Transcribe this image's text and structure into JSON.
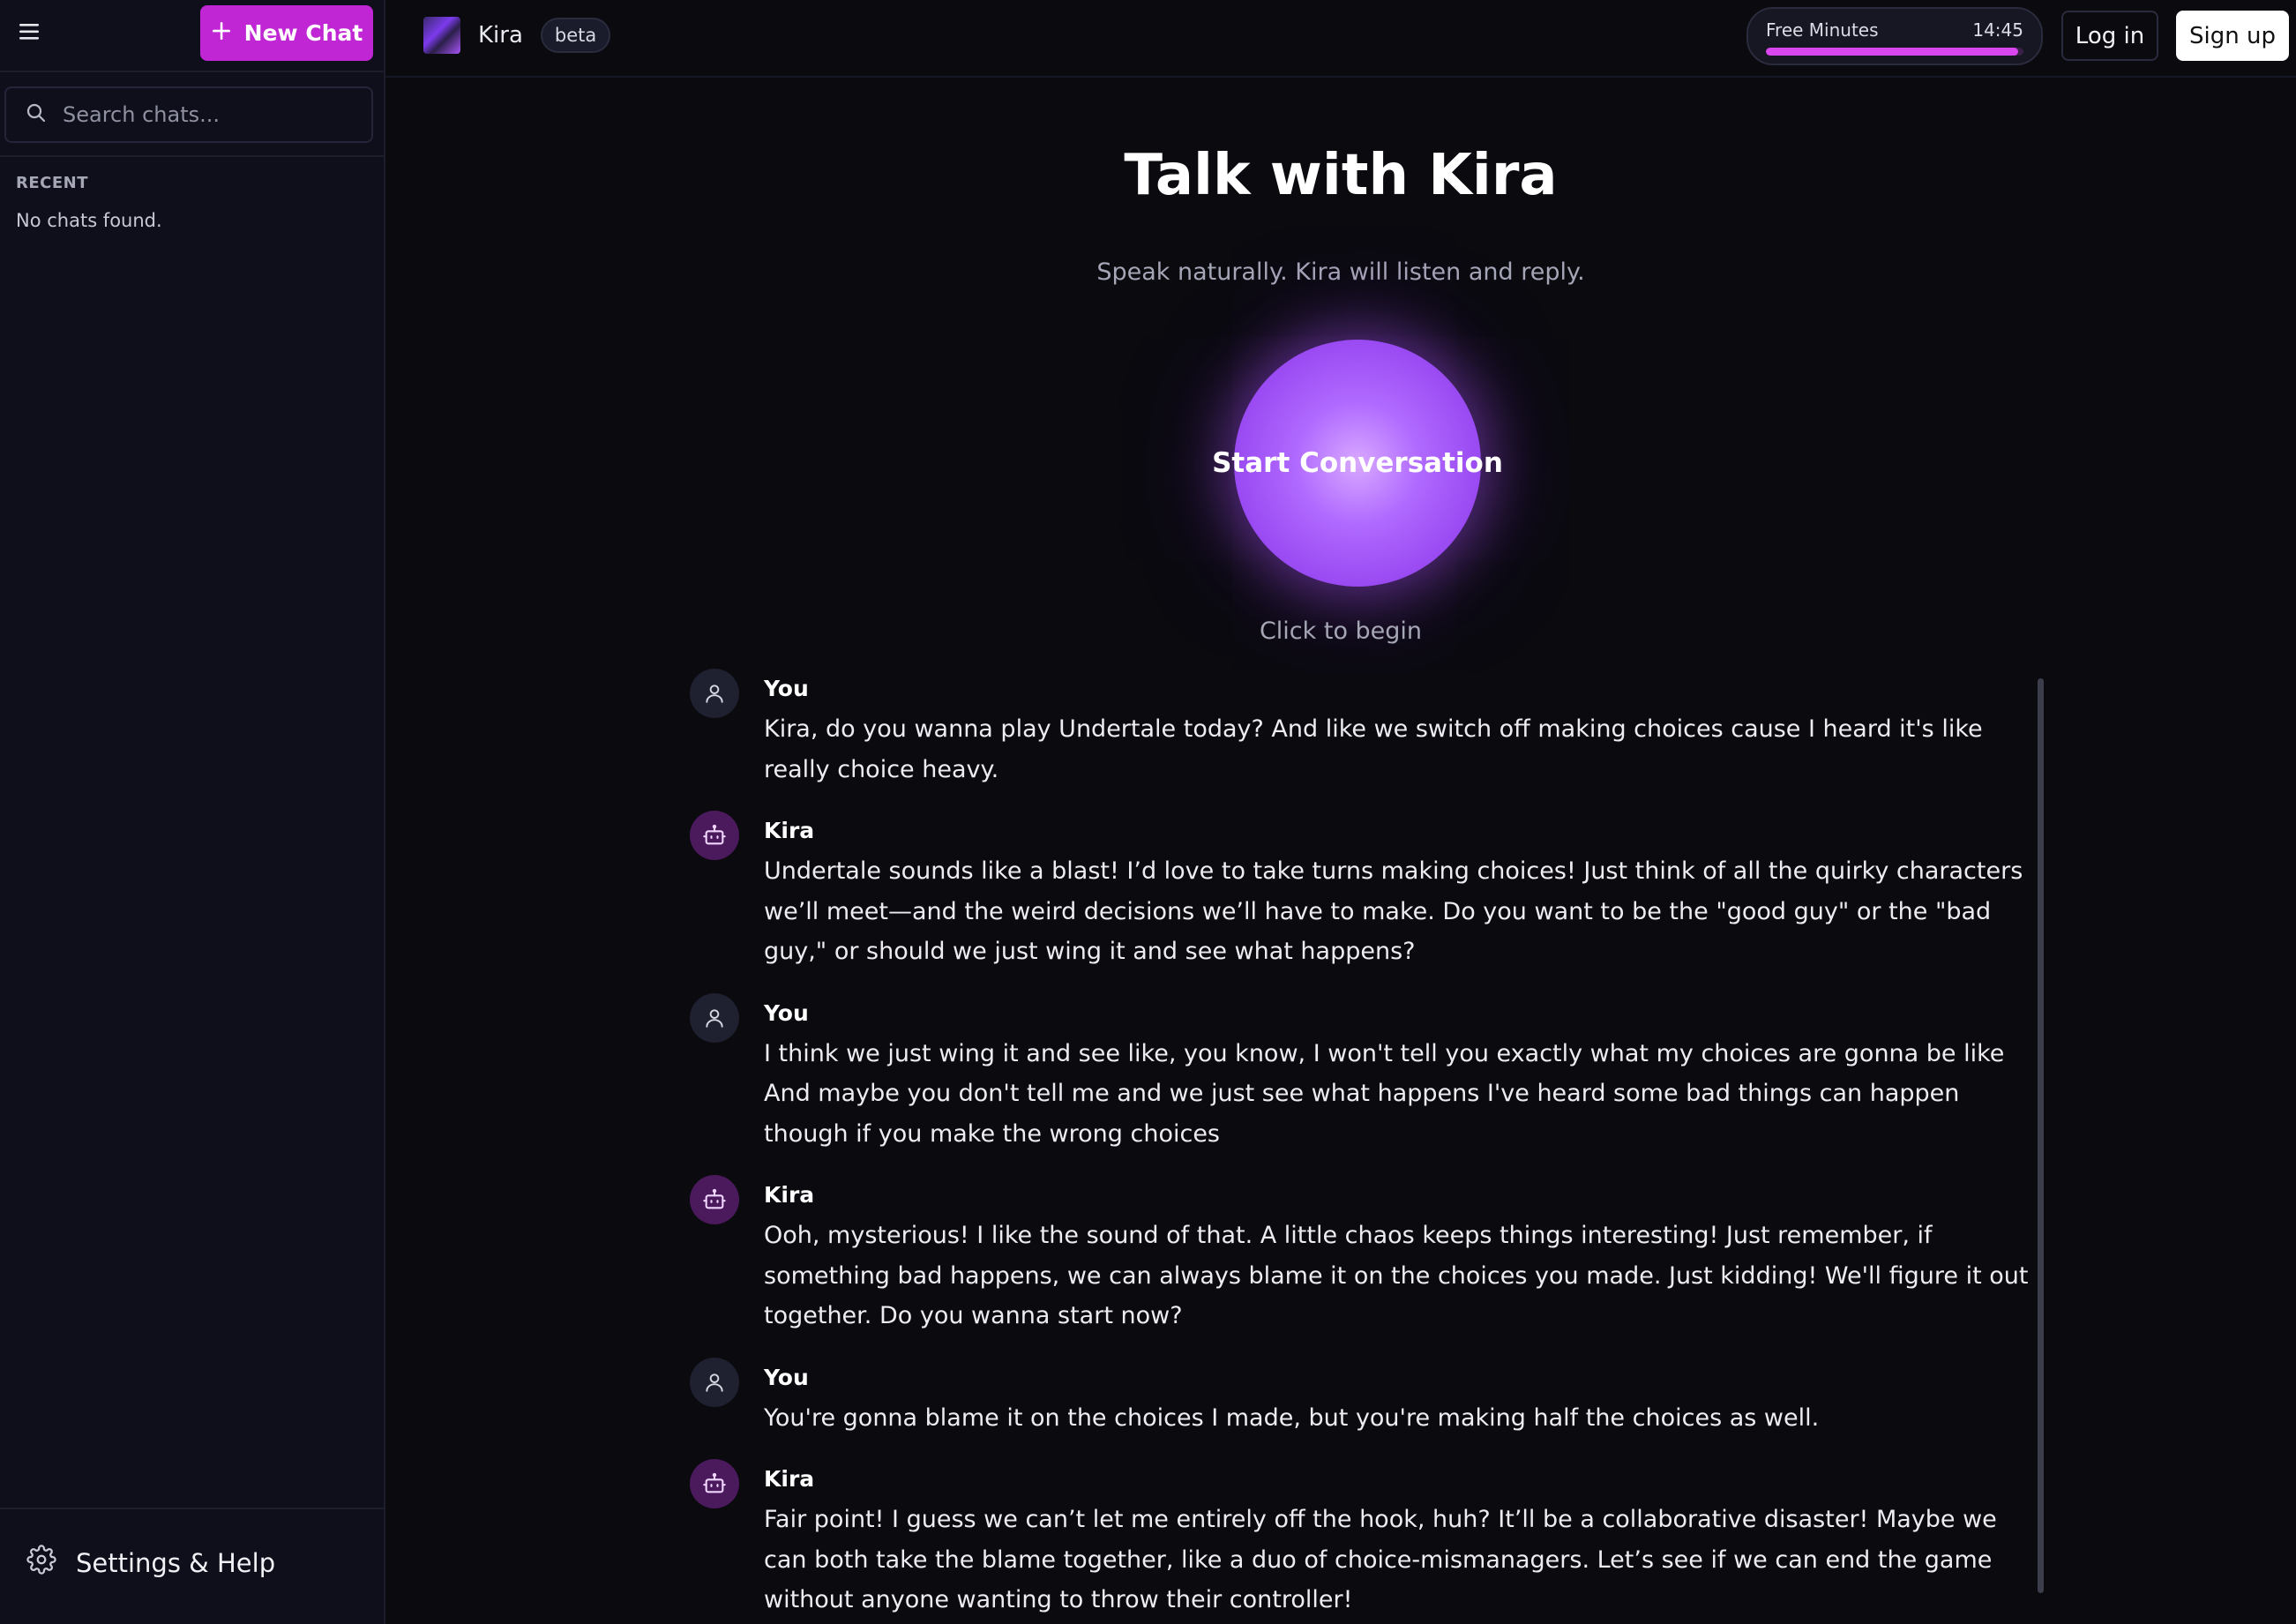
{
  "sidebar": {
    "new_chat_label": "New Chat",
    "search_placeholder": "Search chats...",
    "recent_label": "RECENT",
    "empty_label": "No chats found.",
    "settings_label": "Settings & Help"
  },
  "header": {
    "brand_name": "Kira",
    "beta_label": "beta",
    "free_minutes_label": "Free Minutes",
    "free_minutes_value": "14:45",
    "free_minutes_fraction": 0.98,
    "login_label": "Log in",
    "signup_label": "Sign up"
  },
  "main": {
    "title": "Talk with Kira",
    "subtitle": "Speak naturally. Kira will listen and reply.",
    "start_label": "Start Conversation",
    "hint": "Click to begin"
  },
  "messages": [
    {
      "author": "You",
      "role": "user",
      "text": "Kira, do you wanna play Undertale today? And like we switch off making choices cause I heard it's like really choice heavy."
    },
    {
      "author": "Kira",
      "role": "bot",
      "text": "Undertale sounds like a blast! I’d love to take turns making choices! Just think of all the quirky characters we’ll meet—and the weird decisions we’ll have to make. Do you want to be the \"good guy\" or the \"bad guy,\" or should we just wing it and see what happens?"
    },
    {
      "author": "You",
      "role": "user",
      "text": "I think we just wing it and see like, you know, I won't tell you exactly what my choices are gonna be like And maybe you don't tell me and we just see what happens I've heard some bad things can happen though if you make the wrong choices"
    },
    {
      "author": "Kira",
      "role": "bot",
      "text": "Ooh, mysterious! I like the sound of that. A little chaos keeps things interesting! Just remember, if something bad happens, we can always blame it on the choices you made. Just kidding! We'll figure it out together. Do you wanna start now?"
    },
    {
      "author": "You",
      "role": "user",
      "text": "You're gonna blame it on the choices I made, but you're making half the choices as well."
    },
    {
      "author": "Kira",
      "role": "bot",
      "text": "Fair point! I guess we can’t let me entirely off the hook, huh? It’ll be a collaborative disaster! Maybe we can both take the blame together, like a duo of choice-mismanagers. Let’s see if we can end the game without anyone wanting to throw their controller!"
    }
  ],
  "icons": {
    "menu": "menu-icon",
    "plus": "plus-icon",
    "search": "search-icon",
    "settings": "gear-icon",
    "user_avatar": "user-icon",
    "bot_avatar": "bot-icon"
  },
  "colors": {
    "accent": "#c026d3",
    "orb": "#a855f7",
    "background": "#0a0a0f",
    "sidebar": "#0e0f1b"
  }
}
